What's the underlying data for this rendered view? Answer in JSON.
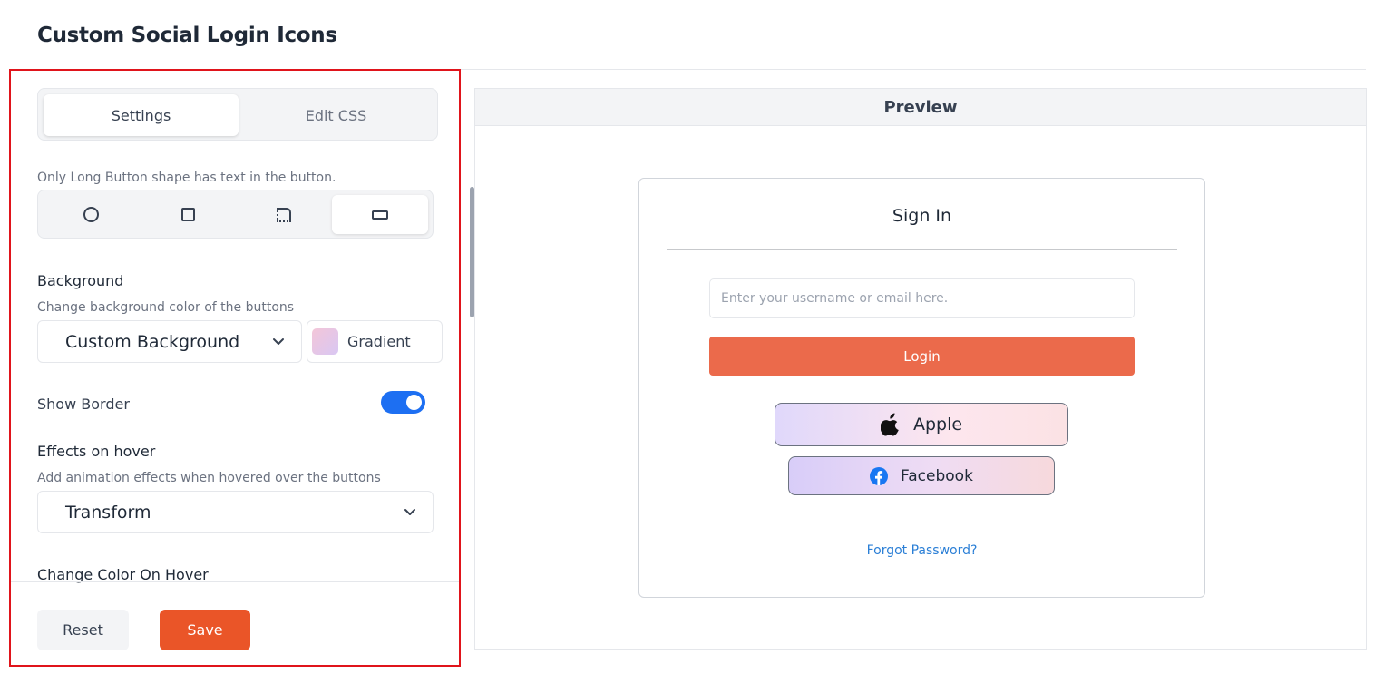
{
  "page": {
    "title": "Custom Social Login Icons"
  },
  "settings": {
    "tabs": [
      {
        "label": "Settings",
        "active": true
      },
      {
        "label": "Edit CSS",
        "active": false
      }
    ],
    "shape_hint": "Only Long Button shape has text in the button.",
    "shapes": [
      {
        "icon": "circle-shape-icon",
        "selected": false
      },
      {
        "icon": "square-shape-icon",
        "selected": false
      },
      {
        "icon": "rounded-corner-shape-icon",
        "selected": false
      },
      {
        "icon": "long-button-shape-icon",
        "selected": true
      }
    ],
    "background": {
      "label": "Background",
      "hint": "Change background color of the buttons",
      "select_value": "Custom Background",
      "gradient_label": "Gradient",
      "swatch_colors": [
        "#f3c6d8",
        "#d9c7f3"
      ]
    },
    "show_border": {
      "label": "Show Border",
      "enabled": true
    },
    "hover_effects": {
      "label": "Effects on hover",
      "hint": "Add animation effects when hovered over the buttons",
      "select_value": "Transform"
    },
    "change_color_on_hover": {
      "label": "Change Color On Hover"
    },
    "footer": {
      "reset_label": "Reset",
      "save_label": "Save"
    }
  },
  "preview": {
    "header": "Preview",
    "signin": {
      "title": "Sign In",
      "username_placeholder": "Enter your username or email here.",
      "login_label": "Login",
      "social_buttons": [
        {
          "label": "Apple",
          "icon": "apple-icon"
        },
        {
          "label": "Facebook",
          "icon": "facebook-icon"
        }
      ],
      "forgot_label": "Forgot Password?"
    }
  },
  "colors": {
    "accent": "#ea5528",
    "login_button": "#eb6a4b",
    "toggle_on": "#1d6ff2",
    "link": "#2b7fd6",
    "highlight_border": "#e0141b"
  }
}
